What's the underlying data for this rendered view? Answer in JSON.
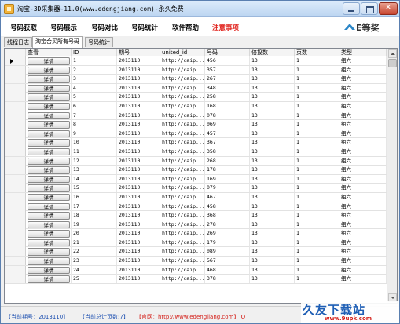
{
  "window": {
    "title": "淘宝-3D采集器-11.0(www.edengjiang.com)-永久免费"
  },
  "menu": {
    "items": [
      {
        "label": "号码获取"
      },
      {
        "label": "号码展示"
      },
      {
        "label": "号码对比"
      },
      {
        "label": "号码统计"
      },
      {
        "label": "软件帮助"
      },
      {
        "label": "注意事项",
        "warn": true
      }
    ]
  },
  "brand": {
    "text": "E等奖",
    "icon": "brand-logo-icon"
  },
  "tabs": [
    "线程日志",
    "淘宝合买所有号码",
    "号码统计"
  ],
  "active_tab": 1,
  "grid": {
    "columns": [
      "",
      "查看",
      "ID",
      "期号",
      "united_id",
      "号码",
      "倍投数",
      "页数",
      "类型"
    ],
    "detail_label": "详情",
    "rows": [
      {
        "id": "1",
        "issue": "2013110",
        "uid": "http://caip...",
        "num": "456",
        "mult": "13",
        "page": "1",
        "type": "组六"
      },
      {
        "id": "2",
        "issue": "2013110",
        "uid": "http://caip...",
        "num": "357",
        "mult": "13",
        "page": "1",
        "type": "组六"
      },
      {
        "id": "3",
        "issue": "2013110",
        "uid": "http://caip...",
        "num": "267",
        "mult": "13",
        "page": "1",
        "type": "组六"
      },
      {
        "id": "4",
        "issue": "2013110",
        "uid": "http://caip...",
        "num": "348",
        "mult": "13",
        "page": "1",
        "type": "组六"
      },
      {
        "id": "5",
        "issue": "2013110",
        "uid": "http://caip...",
        "num": "258",
        "mult": "13",
        "page": "1",
        "type": "组六"
      },
      {
        "id": "6",
        "issue": "2013110",
        "uid": "http://caip...",
        "num": "168",
        "mult": "13",
        "page": "1",
        "type": "组六"
      },
      {
        "id": "7",
        "issue": "2013110",
        "uid": "http://caip...",
        "num": "078",
        "mult": "13",
        "page": "1",
        "type": "组六"
      },
      {
        "id": "8",
        "issue": "2013110",
        "uid": "http://caip...",
        "num": "069",
        "mult": "13",
        "page": "1",
        "type": "组六"
      },
      {
        "id": "9",
        "issue": "2013110",
        "uid": "http://caip...",
        "num": "457",
        "mult": "13",
        "page": "1",
        "type": "组六"
      },
      {
        "id": "10",
        "issue": "2013110",
        "uid": "http://caip...",
        "num": "367",
        "mult": "13",
        "page": "1",
        "type": "组六"
      },
      {
        "id": "11",
        "issue": "2013110",
        "uid": "http://caip...",
        "num": "358",
        "mult": "13",
        "page": "1",
        "type": "组六"
      },
      {
        "id": "12",
        "issue": "2013110",
        "uid": "http://caip...",
        "num": "268",
        "mult": "13",
        "page": "1",
        "type": "组六"
      },
      {
        "id": "13",
        "issue": "2013110",
        "uid": "http://caip...",
        "num": "178",
        "mult": "13",
        "page": "1",
        "type": "组六"
      },
      {
        "id": "14",
        "issue": "2013110",
        "uid": "http://caip...",
        "num": "169",
        "mult": "13",
        "page": "1",
        "type": "组六"
      },
      {
        "id": "15",
        "issue": "2013110",
        "uid": "http://caip...",
        "num": "079",
        "mult": "13",
        "page": "1",
        "type": "组六"
      },
      {
        "id": "16",
        "issue": "2013110",
        "uid": "http://caip...",
        "num": "467",
        "mult": "13",
        "page": "1",
        "type": "组六"
      },
      {
        "id": "17",
        "issue": "2013110",
        "uid": "http://caip...",
        "num": "458",
        "mult": "13",
        "page": "1",
        "type": "组六"
      },
      {
        "id": "18",
        "issue": "2013110",
        "uid": "http://caip...",
        "num": "368",
        "mult": "13",
        "page": "1",
        "type": "组六"
      },
      {
        "id": "19",
        "issue": "2013110",
        "uid": "http://caip...",
        "num": "278",
        "mult": "13",
        "page": "1",
        "type": "组六"
      },
      {
        "id": "20",
        "issue": "2013110",
        "uid": "http://caip...",
        "num": "269",
        "mult": "13",
        "page": "1",
        "type": "组六"
      },
      {
        "id": "21",
        "issue": "2013110",
        "uid": "http://caip...",
        "num": "179",
        "mult": "13",
        "page": "1",
        "type": "组六"
      },
      {
        "id": "22",
        "issue": "2013110",
        "uid": "http://caip...",
        "num": "089",
        "mult": "13",
        "page": "1",
        "type": "组六"
      },
      {
        "id": "23",
        "issue": "2013110",
        "uid": "http://caip...",
        "num": "567",
        "mult": "13",
        "page": "1",
        "type": "组六"
      },
      {
        "id": "24",
        "issue": "2013110",
        "uid": "http://caip...",
        "num": "468",
        "mult": "13",
        "page": "1",
        "type": "组六"
      },
      {
        "id": "25",
        "issue": "2013110",
        "uid": "http://caip...",
        "num": "378",
        "mult": "13",
        "page": "1",
        "type": "组六"
      }
    ]
  },
  "status": {
    "current_issue": "【当前期号：2013110】",
    "total_pages": "【当前总计页数:7】",
    "website": "【官网：http://www.edengjiang.com】 Q"
  },
  "watermark": {
    "main": "久友下载站",
    "url": "www.9upk.com"
  },
  "colors": {
    "title_bar": "#bcd5f1",
    "warn_menu": "#e0201a",
    "status_blue": "#1c4fb0",
    "status_red": "#d4201a"
  }
}
